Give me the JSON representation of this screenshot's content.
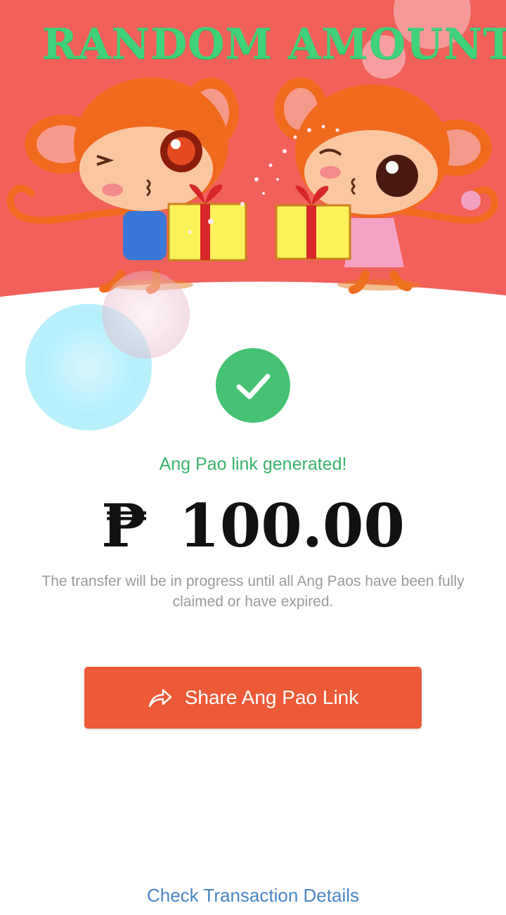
{
  "banner": {
    "title": "RANDOM AMOUNT"
  },
  "status": {
    "message": "Ang Pao link generated!"
  },
  "amount": {
    "currency": "₱",
    "value": "100.00"
  },
  "description": "The transfer will be in progress until all Ang Paos have been fully claimed or have expired.",
  "share_button": {
    "label": "Share Ang Pao Link",
    "icon": "share-arrow-icon"
  },
  "details_link": "Check Transaction Details",
  "colors": {
    "banner_bg": "#f1605a",
    "banner_title": "#3fd27b",
    "success": "#44c271",
    "status_text": "#3ab26b",
    "button": "#ec5a37",
    "link": "#4a86c5"
  }
}
